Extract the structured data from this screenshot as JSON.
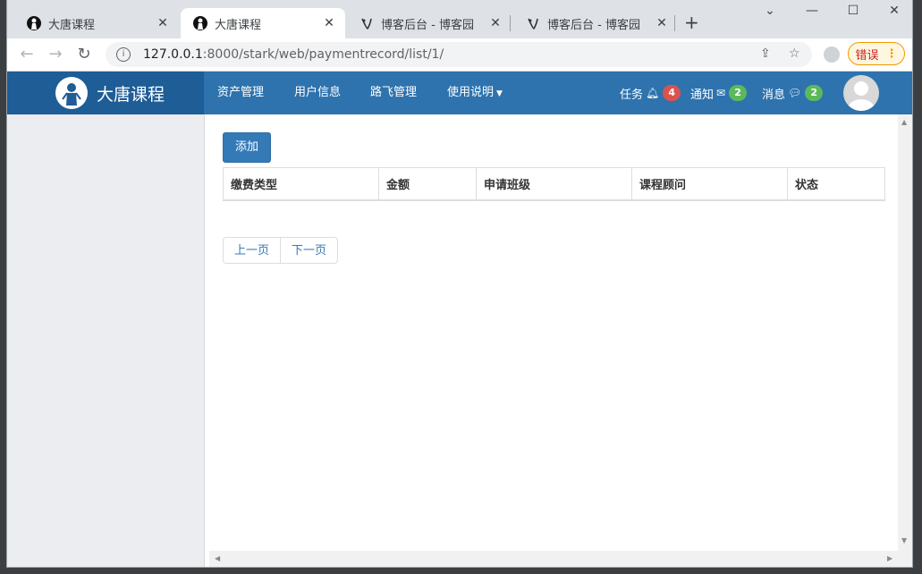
{
  "tabs": [
    {
      "title": "大唐课程",
      "active": false
    },
    {
      "title": "大唐课程",
      "active": true
    },
    {
      "title": "博客后台 - 博客园",
      "active": false
    },
    {
      "title": "博客后台 - 博客园",
      "active": false
    }
  ],
  "window_controls": {
    "minimize": "—",
    "maximize": "☐",
    "close": "✕",
    "chevron": "⌄"
  },
  "address": {
    "host": "127.0.0.1",
    "path": ":8000/stark/web/paymentrecord/list/1/"
  },
  "error_button": {
    "label": "错误"
  },
  "app": {
    "brand": "大唐课程",
    "menu": [
      "资产管理",
      "用户信息",
      "路飞管理",
      "使用说明"
    ],
    "notifications": [
      {
        "label": "任务",
        "count": "4",
        "color": "#d9534f"
      },
      {
        "label": "通知",
        "count": "2",
        "color": "#5cb85c"
      },
      {
        "label": "消息",
        "count": "2",
        "color": "#5cb85c"
      }
    ]
  },
  "page": {
    "add_button": "添加",
    "columns": [
      "缴费类型",
      "金额",
      "申请班级",
      "课程顾问",
      "状态"
    ],
    "pager": {
      "prev": "上一页",
      "next": "下一页"
    }
  }
}
